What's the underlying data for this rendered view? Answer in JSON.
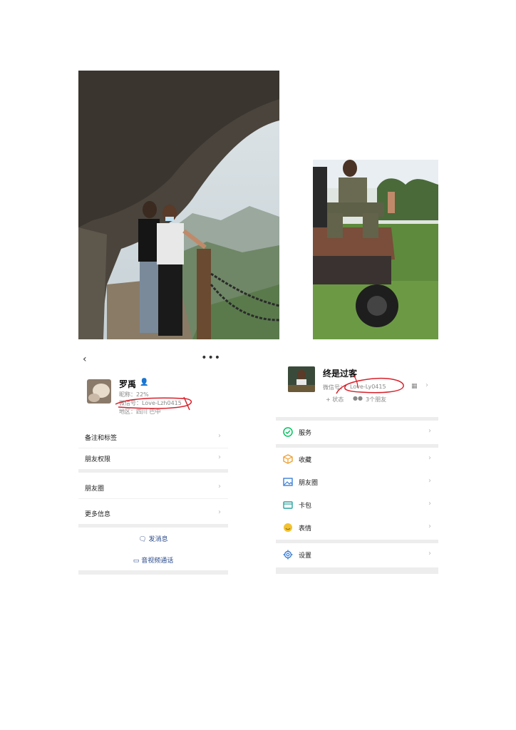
{
  "left_profile": {
    "back_icon": "chevron-left-icon",
    "more_icon": "more-horizontal-icon",
    "name": "罗禹",
    "nickname": "昵称：22%",
    "wechat_id": "微信号：Love-Lzh0415",
    "region": "地区：四川 巴中",
    "rows": [
      {
        "label": "备注和标签"
      },
      {
        "label": "朋友权限"
      },
      {
        "label": "朋友圈"
      },
      {
        "label": "更多信息"
      }
    ],
    "send_message": "发消息",
    "video_call": "音视频通话"
  },
  "right_profile": {
    "name": "终是过客",
    "wechat_id_label": "微信号：",
    "wechat_id": "Love-Ly0415",
    "status": "+ 状态",
    "friends": "3个朋友",
    "menu": [
      {
        "label": "服务",
        "icon": "service-icon",
        "color": "#07c160"
      },
      {
        "label": "收藏",
        "icon": "favorites-cube-icon",
        "color": "#f0a030"
      },
      {
        "label": "朋友圈",
        "icon": "moments-image-icon",
        "color": "#3b7fd9"
      },
      {
        "label": "卡包",
        "icon": "card-wallet-icon",
        "color": "#2aa3a0"
      },
      {
        "label": "表情",
        "icon": "emoji-smile-icon",
        "color": "#f2c232"
      },
      {
        "label": "设置",
        "icon": "settings-gear-icon",
        "color": "#3b7fd9"
      }
    ]
  },
  "colors": {
    "annotation_red": "#d8202a",
    "link_blue": "#2a4a8a",
    "divider": "#eeeeee"
  }
}
